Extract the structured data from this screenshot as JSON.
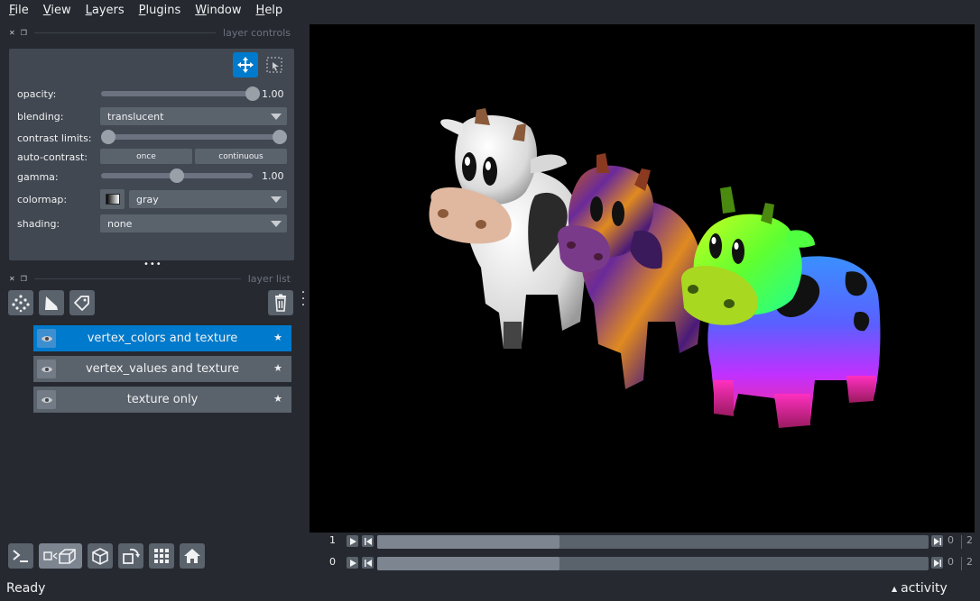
{
  "menubar": {
    "items": [
      {
        "label": "File",
        "mnemonic": "F",
        "rest": "ile"
      },
      {
        "label": "View",
        "mnemonic": "V",
        "rest": "iew"
      },
      {
        "label": "Layers",
        "mnemonic": "L",
        "rest": "ayers"
      },
      {
        "label": "Plugins",
        "mnemonic": "P",
        "rest": "lugins"
      },
      {
        "label": "Window",
        "mnemonic": "W",
        "rest": "indow"
      },
      {
        "label": "Help",
        "mnemonic": "H",
        "rest": "elp"
      }
    ]
  },
  "layer_controls": {
    "title": "layer controls",
    "opacity": {
      "label": "opacity:",
      "value": "1.00",
      "level": 1.0
    },
    "blending": {
      "label": "blending:",
      "value": "translucent"
    },
    "contrast_limits": {
      "label": "contrast limits:",
      "low": 0.0,
      "high": 1.0
    },
    "auto_contrast": {
      "label": "auto-contrast:",
      "once": "once",
      "continuous": "continuous"
    },
    "gamma": {
      "label": "gamma:",
      "value": "1.00",
      "level": 0.5
    },
    "colormap": {
      "label": "colormap:",
      "value": "gray"
    },
    "shading": {
      "label": "shading:",
      "value": "none"
    }
  },
  "layer_list": {
    "title": "layer list",
    "layers": [
      {
        "name": "vertex_colors and texture",
        "selected": true
      },
      {
        "name": "vertex_values and texture",
        "selected": false
      },
      {
        "name": "texture only",
        "selected": false
      }
    ]
  },
  "dims": [
    {
      "index": "1",
      "start": "0",
      "end": "2",
      "fill": 0.33
    },
    {
      "index": "0",
      "start": "0",
      "end": "2",
      "fill": 0.33
    }
  ],
  "status": {
    "ready": "Ready",
    "activity": "activity"
  },
  "colors": {
    "accent": "#007acc",
    "background": "#262930",
    "panel": "#414851"
  }
}
